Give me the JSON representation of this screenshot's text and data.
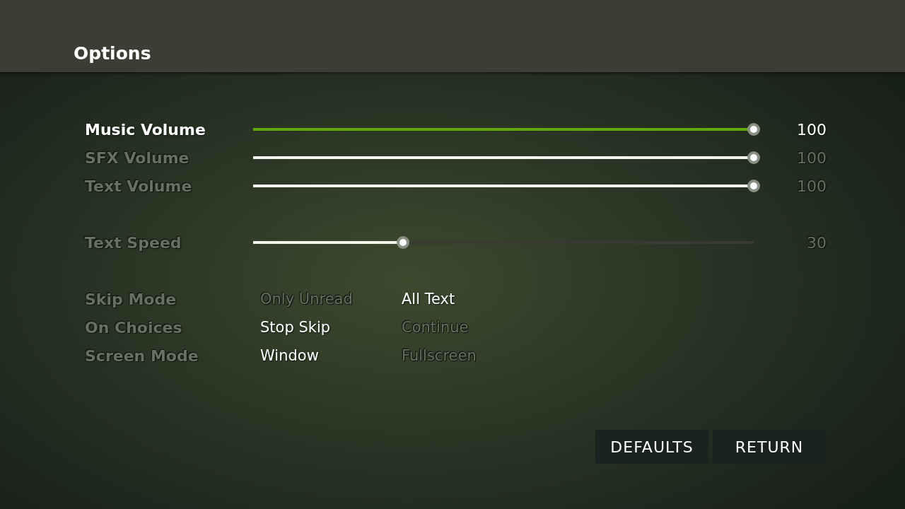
{
  "title": "Options",
  "slider_groups": [
    [
      {
        "label": "Music Volume",
        "focused": true,
        "level": 1,
        "reading": "100"
      },
      {
        "label": "SFX Volume",
        "focused": false,
        "level": 1,
        "reading": "100"
      },
      {
        "label": "Text Volume",
        "focused": false,
        "level": 1,
        "reading": "100"
      }
    ],
    [
      {
        "label": "Text Speed",
        "focused": false,
        "level": 0.3,
        "reading": "30"
      }
    ]
  ],
  "choices": [
    {
      "label": "Skip Mode",
      "options": [
        {
          "label": "Only Unread",
          "selected": false
        },
        {
          "label": "All Text",
          "selected": true
        }
      ]
    },
    {
      "label": "On Choices",
      "options": [
        {
          "label": "Stop Skip",
          "selected": true
        },
        {
          "label": "Continue",
          "selected": false
        }
      ]
    },
    {
      "label": "Screen Mode",
      "options": [
        {
          "label": "Window",
          "selected": true
        },
        {
          "label": "Fullscreen",
          "selected": false
        }
      ]
    }
  ],
  "buttons": [
    "DEFAULTS",
    "RETURN"
  ]
}
